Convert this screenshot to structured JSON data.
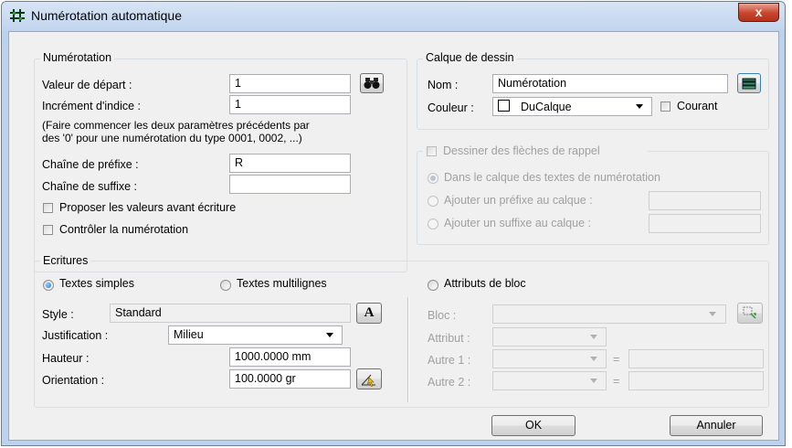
{
  "window": {
    "title": "Numérotation automatique",
    "close_label": "x"
  },
  "numerotation": {
    "legend": "Numérotation",
    "start_label": "Valeur de départ :",
    "start_value": "1",
    "increment_label": "Incrément d'indice :",
    "increment_value": "1",
    "help_line1": "(Faire commencer les deux paramètres précédents par",
    "help_line2": "des '0' pour une numérotation du type 0001, 0002, ...)",
    "prefix_label": "Chaîne de préfixe :",
    "prefix_value": "R",
    "suffix_label": "Chaîne de suffixe :",
    "suffix_value": "",
    "propose_label": "Proposer les valeurs avant écriture",
    "control_label": "Contrôler la numérotation"
  },
  "calque": {
    "legend": "Calque de dessin",
    "name_label": "Nom :",
    "name_value": "Numérotation",
    "color_label": "Couleur :",
    "color_value": "DuCalque",
    "courant_label": "Courant"
  },
  "fleches": {
    "legend": "Dessiner des flèches de rappel",
    "opt1": "Dans le calque des textes de numérotation",
    "opt2": "Ajouter un préfixe au calque :",
    "opt3": "Ajouter un suffixe au calque :"
  },
  "ecritures": {
    "legend": "Ecritures",
    "simple_label": "Textes simples",
    "multi_label": "Textes multilignes",
    "attr_label": "Attributs de bloc",
    "style_label": "Style :",
    "style_value": "Standard",
    "style_btn": "A",
    "justif_label": "Justification :",
    "justif_value": "Milieu",
    "height_label": "Hauteur :",
    "height_value": "1000.0000 mm",
    "orient_label": "Orientation :",
    "orient_value": "100.0000 gr",
    "bloc_label": "Bloc :",
    "attribut_label": "Attribut :",
    "autre1_label": "Autre 1 :",
    "autre2_label": "Autre 2 :",
    "equals": "="
  },
  "buttons": {
    "ok": "OK",
    "cancel": "Annuler"
  }
}
